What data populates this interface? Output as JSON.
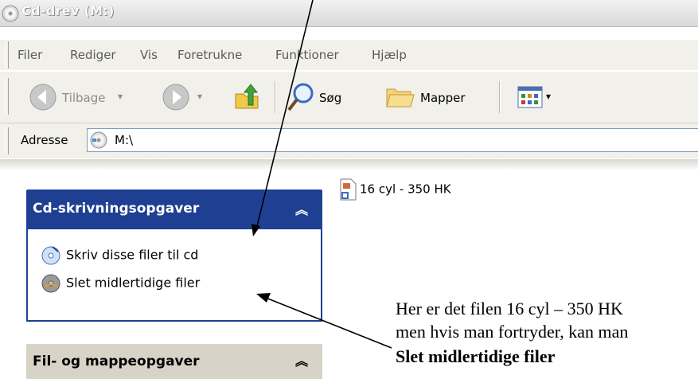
{
  "window": {
    "title": "Cd-drev (M:)"
  },
  "menubar": {
    "items": [
      "Filer",
      "Rediger",
      "Vis",
      "Foretrukne",
      "Funktioner",
      "Hjælp"
    ]
  },
  "toolbar": {
    "back_label": "Tilbage",
    "search_label": "Søg",
    "folders_label": "Mapper"
  },
  "address": {
    "label": "Adresse",
    "value": "M:\\"
  },
  "cd_tasks": {
    "title": "Cd-skrivningsopgaver",
    "items": [
      "Skriv disse filer til cd",
      "Slet midlertidige filer"
    ]
  },
  "file_tasks": {
    "title": "Fil- og mappeopgaver"
  },
  "file": {
    "name": "16 cyl - 350 HK"
  },
  "annotation": {
    "line1": "Her er det filen 16 cyl – 350 HK",
    "line2": "men hvis man fortryder, kan man",
    "line3": "Slet midlertidige filer"
  },
  "icons": [
    "cd-drive-icon",
    "back-arrow-icon",
    "forward-arrow-icon",
    "folder-up-icon",
    "search-icon",
    "folders-icon",
    "views-icon",
    "burn-cd-icon",
    "delete-temp-files-icon",
    "file-icon",
    "collapse-chevron-icon"
  ]
}
